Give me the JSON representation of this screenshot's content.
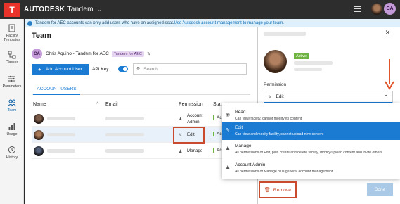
{
  "topbar": {
    "brand_bold": "AUTODESK",
    "brand_light": "Tandem",
    "user_initials": "CA"
  },
  "nav": [
    {
      "label": "Facility\nTemplates",
      "icon": "facility-templates-icon"
    },
    {
      "label": "Classes",
      "icon": "classes-icon"
    },
    {
      "label": "Parameters",
      "icon": "parameters-icon"
    },
    {
      "label": "Team",
      "icon": "team-icon",
      "active": true
    },
    {
      "label": "Usage",
      "icon": "usage-icon"
    },
    {
      "label": "History",
      "icon": "history-icon"
    }
  ],
  "banner": {
    "text": "Tandem for AEC accounts can only add users who have an assigned seat.",
    "link": "Use Autodesk account management to manage your team."
  },
  "main": {
    "title": "Team",
    "owner_initials": "CA",
    "owner_name": "Chris Aquino - Tandem for AEC",
    "owner_badge": "Tandem for AEC",
    "add_button": "Add Account User",
    "api_key_label": "API Key",
    "search_placeholder": "Search",
    "tab": "ACCOUNT USERS",
    "columns": {
      "name": "Name",
      "email": "Email",
      "permission": "Permission",
      "status": "Status"
    },
    "rows": [
      {
        "perm_line1": "Account",
        "perm_line2": "Admin",
        "status": "Ac"
      },
      {
        "perm": "Edit",
        "status": "Ac"
      },
      {
        "perm": "Manage",
        "status": "Ac"
      }
    ]
  },
  "panel": {
    "active_badge": "Active",
    "permission_label": "Permission",
    "selected": "Edit",
    "options": [
      {
        "title": "Read",
        "desc": "Can view facility, cannot modify its content"
      },
      {
        "title": "Edit",
        "desc": "Can view and modify facility, cannot upload new content"
      },
      {
        "title": "Manage",
        "desc": "All permissions of Edit, plus create and delete facility, modify/upload content and invite others"
      },
      {
        "title": "Account Admin",
        "desc": "All permissions of Manage plus general account management"
      }
    ],
    "remove_label": "Remove",
    "done_label": "Done"
  },
  "colors": {
    "accent": "#1b7bd3",
    "highlight_box": "#c94a2c",
    "active": "#6fb442"
  }
}
